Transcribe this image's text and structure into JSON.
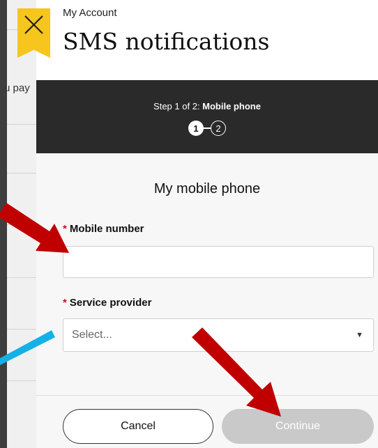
{
  "background_page": {
    "partial_text": "u pay"
  },
  "header": {
    "overline": "My Account",
    "title": "SMS notifications"
  },
  "stepper": {
    "prefix": "Step 1 of 2: ",
    "current_step_name": "Mobile phone",
    "steps": [
      "1",
      "2"
    ],
    "current": 1
  },
  "form": {
    "section_title": "My mobile phone",
    "mobile_label": "Mobile number",
    "mobile_value": "",
    "provider_label": "Service provider",
    "provider_selected": "Select...",
    "required_marker": "*"
  },
  "footer": {
    "cancel_label": "Cancel",
    "continue_label": "Continue"
  },
  "colors": {
    "accent": "#f6c51e",
    "step_bar": "#2a2a2a",
    "required": "#c8102e",
    "disabled_button": "#c9c9c9",
    "arrow_red": "#c00000",
    "arrow_blue": "#14b1e7"
  }
}
